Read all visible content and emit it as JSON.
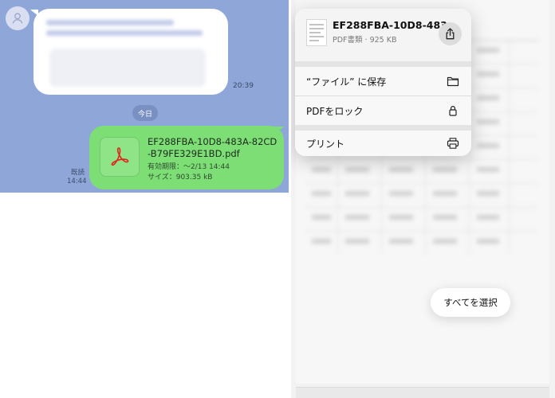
{
  "chat": {
    "time_incoming": "20:39",
    "date_label": "今日",
    "file": {
      "name": "EF288FBA-10D8-483A-82CD-B79FE329E1BD.pdf",
      "expiry": "有効期限：〜2/13 14:44",
      "size": "サイズ：903.35 kB"
    },
    "read_status": "既読",
    "time_outgoing": "14:44"
  },
  "share_sheet": {
    "title": "EF288FBA-10D8-483...",
    "subtitle": "PDF書類 · 925 KB",
    "actions": [
      {
        "label": "“ファイル” に保存",
        "icon": "folder-icon"
      },
      {
        "label": "PDFをロック",
        "icon": "lock-icon"
      },
      {
        "label": "プリント",
        "icon": "printer-icon"
      }
    ]
  },
  "select_all_label": "すべてを選択",
  "colors": {
    "chat_background": "#8ea6d8",
    "outgoing_bubble": "#7dde76",
    "incoming_bubble": "#ffffff",
    "pdf_red": "#e2231a"
  }
}
